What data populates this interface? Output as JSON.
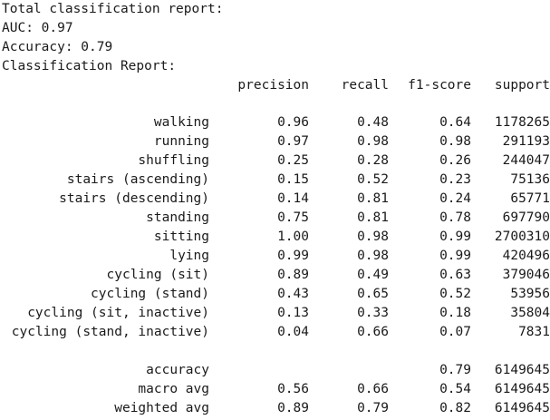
{
  "header": {
    "title": "Total classification report:",
    "auc": "AUC: 0.97",
    "accuracy": "Accuracy: 0.79",
    "report_title": "Classification Report:"
  },
  "table": {
    "columns": [
      "precision",
      "recall",
      "f1-score",
      "support"
    ],
    "rows": [
      {
        "label": "walking",
        "precision": "0.96",
        "recall": "0.48",
        "f1": "0.64",
        "support": "1178265"
      },
      {
        "label": "running",
        "precision": "0.97",
        "recall": "0.98",
        "f1": "0.98",
        "support": "291193"
      },
      {
        "label": "shuffling",
        "precision": "0.25",
        "recall": "0.28",
        "f1": "0.26",
        "support": "244047"
      },
      {
        "label": "stairs (ascending)",
        "precision": "0.15",
        "recall": "0.52",
        "f1": "0.23",
        "support": "75136"
      },
      {
        "label": "stairs (descending)",
        "precision": "0.14",
        "recall": "0.81",
        "f1": "0.24",
        "support": "65771"
      },
      {
        "label": "standing",
        "precision": "0.75",
        "recall": "0.81",
        "f1": "0.78",
        "support": "697790"
      },
      {
        "label": "sitting",
        "precision": "1.00",
        "recall": "0.98",
        "f1": "0.99",
        "support": "2700310"
      },
      {
        "label": "lying",
        "precision": "0.99",
        "recall": "0.98",
        "f1": "0.99",
        "support": "420496"
      },
      {
        "label": "cycling (sit)",
        "precision": "0.89",
        "recall": "0.49",
        "f1": "0.63",
        "support": "379046"
      },
      {
        "label": "cycling (stand)",
        "precision": "0.43",
        "recall": "0.65",
        "f1": "0.52",
        "support": "53956"
      },
      {
        "label": "cycling (sit, inactive)",
        "precision": "0.13",
        "recall": "0.33",
        "f1": "0.18",
        "support": "35804"
      },
      {
        "label": "cycling (stand, inactive)",
        "precision": "0.04",
        "recall": "0.66",
        "f1": "0.07",
        "support": "7831"
      }
    ],
    "summary": [
      {
        "label": "accuracy",
        "precision": "",
        "recall": "",
        "f1": "0.79",
        "support": "6149645"
      },
      {
        "label": "macro avg",
        "precision": "0.56",
        "recall": "0.66",
        "f1": "0.54",
        "support": "6149645"
      },
      {
        "label": "weighted avg",
        "precision": "0.89",
        "recall": "0.79",
        "f1": "0.82",
        "support": "6149645"
      }
    ]
  }
}
